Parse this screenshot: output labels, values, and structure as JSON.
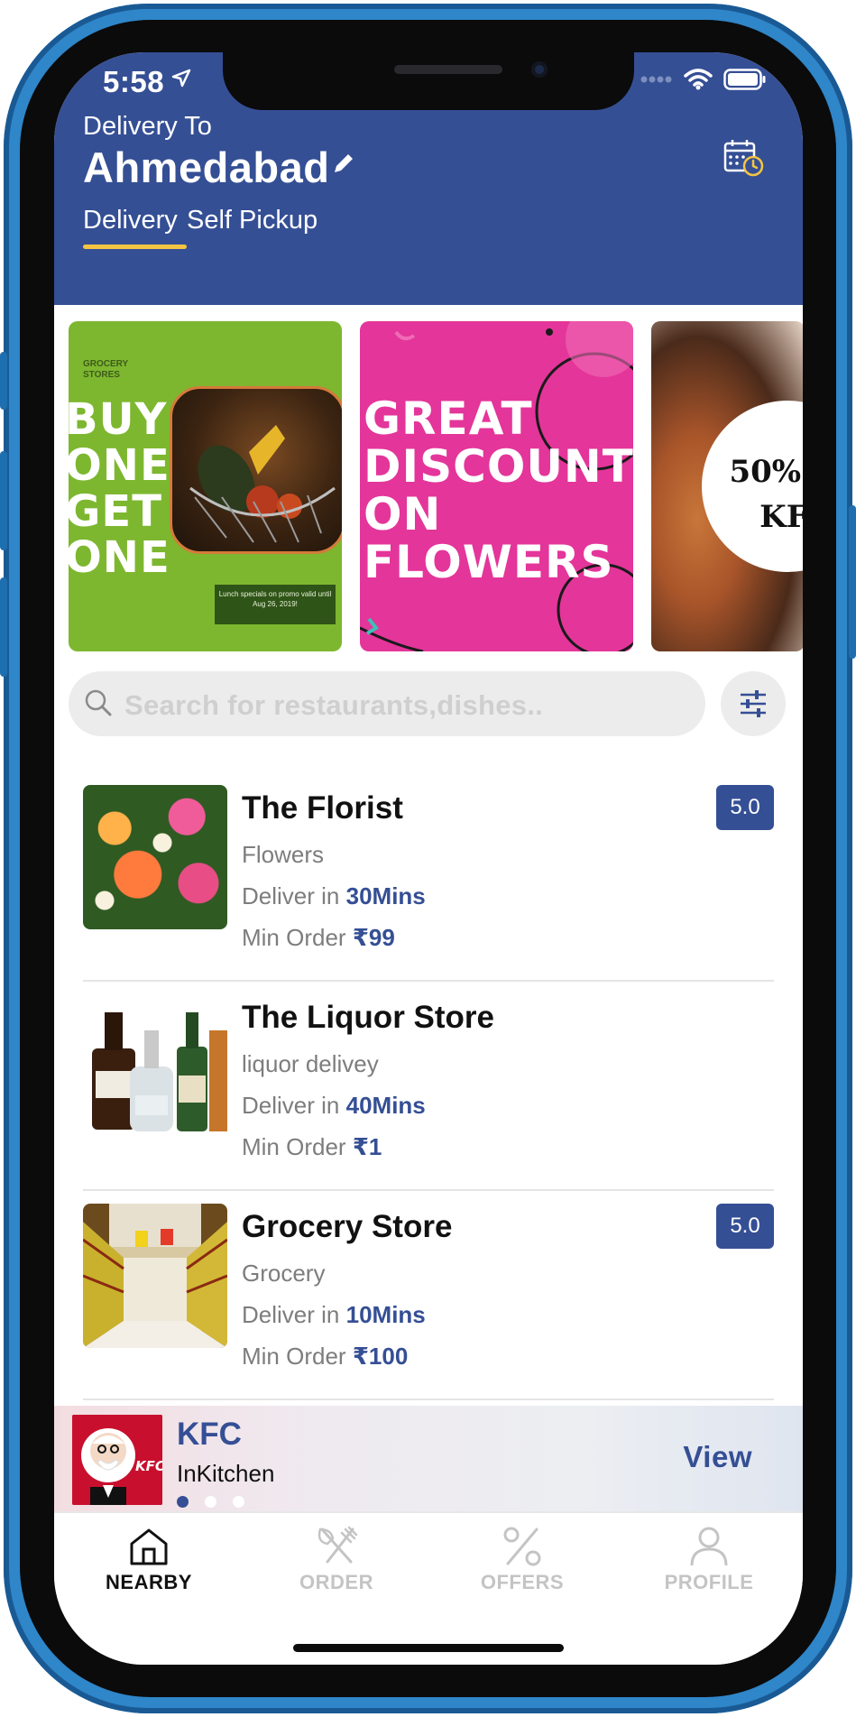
{
  "status_bar": {
    "time": "5:58"
  },
  "header": {
    "delivery_to_label": "Delivery To",
    "city": "Ahmedabad",
    "tabs": [
      {
        "label": "Delivery",
        "active": true
      },
      {
        "label": "Self Pickup",
        "active": false
      }
    ]
  },
  "banners": [
    {
      "logo": "GROCERY\nSTORES",
      "headline": "BUY\nONE\nGET\nONE",
      "note": "Lunch specials on promo valid until Aug 26, 2019!"
    },
    {
      "headline": "GREAT\nDISCOUNT\nON\nFLOWERS"
    },
    {
      "headline": "50% O\nKF"
    }
  ],
  "search": {
    "placeholder": "Search for restaurants,dishes.."
  },
  "stores": [
    {
      "name": "The Florist",
      "category": "Flowers",
      "deliver_prefix": "Deliver in",
      "deliver_time": "30Mins",
      "min_prefix": "Min Order",
      "min_order": "₹99",
      "rating": "5.0"
    },
    {
      "name": "The Liquor Store",
      "category": "liquor delivey",
      "deliver_prefix": "Deliver in",
      "deliver_time": "40Mins",
      "min_prefix": "Min Order",
      "min_order": "₹1",
      "rating": null
    },
    {
      "name": "Grocery Store",
      "category": "Grocery",
      "deliver_prefix": "Deliver in",
      "deliver_time": "10Mins",
      "min_prefix": "Min Order",
      "min_order": "₹100",
      "rating": "5.0"
    }
  ],
  "promo": {
    "title": "KFC",
    "subtitle": "InKitchen",
    "action": "View",
    "logo_text": "KFC",
    "page_count": 3,
    "active_page": 1
  },
  "bottom_nav": [
    {
      "label": "NEARBY",
      "icon": "home-icon",
      "active": true
    },
    {
      "label": "ORDER",
      "icon": "fork-knife-icon",
      "active": false
    },
    {
      "label": "OFFERS",
      "icon": "percent-icon",
      "active": false
    },
    {
      "label": "PROFILE",
      "icon": "user-icon",
      "active": false
    }
  ],
  "colors": {
    "primary": "#354f95",
    "accent": "#f4c542",
    "banner_green": "#7db72f",
    "banner_pink": "#e4359a"
  }
}
